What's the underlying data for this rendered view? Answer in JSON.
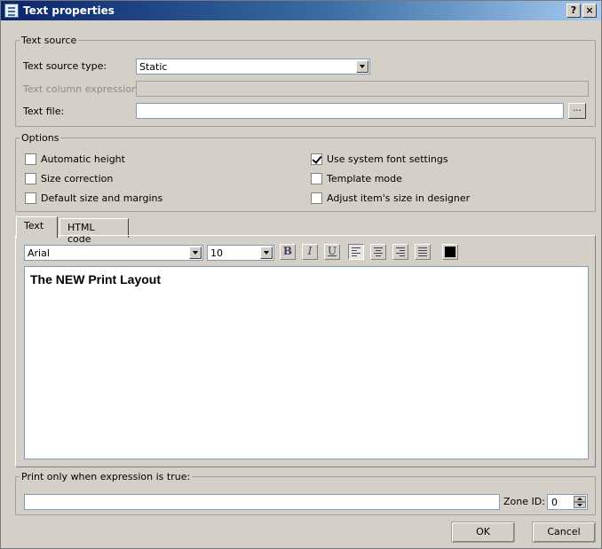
{
  "window": {
    "title": "Text properties",
    "help_label": "?",
    "close_label": "×"
  },
  "text_source": {
    "legend": "Text source",
    "type_label": "Text source type:",
    "type_value": "Static",
    "column_label": "Text column expression:",
    "column_value": "",
    "file_label": "Text file:",
    "file_value": "",
    "browse_label": "..."
  },
  "options": {
    "legend": "Options",
    "items": [
      {
        "label": "Automatic height",
        "checked": false
      },
      {
        "label": "Use system font settings",
        "checked": true
      },
      {
        "label": "Size correction",
        "checked": false
      },
      {
        "label": "Template mode",
        "checked": false
      },
      {
        "label": "Default size and margins",
        "checked": false
      },
      {
        "label": "Adjust item's size in designer",
        "checked": false
      }
    ]
  },
  "tabs": [
    {
      "label": "Text",
      "active": true
    },
    {
      "label": "HTML code",
      "active": false
    }
  ],
  "toolbar": {
    "font_value": "Arial",
    "size_value": "10",
    "bold_label": "B",
    "italic_label": "I",
    "underline_label": "U",
    "text_color": "#000000"
  },
  "editor": {
    "content": "The NEW Print Layout"
  },
  "print_condition": {
    "legend": "Print only when expression is true:",
    "expression_value": "",
    "zone_label": "Zone ID:",
    "zone_value": "0"
  },
  "buttons": {
    "ok_label": "OK",
    "cancel_label": "Cancel"
  }
}
